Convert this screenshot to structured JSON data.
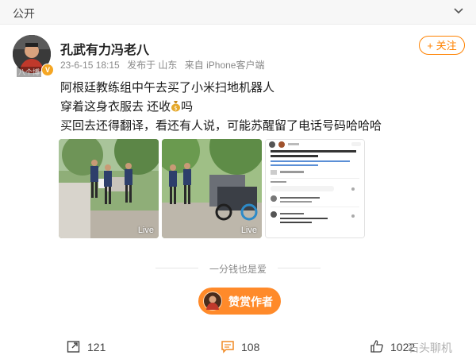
{
  "header": {
    "visibility": "公开"
  },
  "author": {
    "name": "孔武有力冯老八",
    "avatar_caption": "八个博",
    "verified_badge": "V",
    "meta": {
      "date": "23-6-15 18:15",
      "published_from": "发布于 山东",
      "device": "来自 iPhone客户端"
    }
  },
  "follow_button": {
    "label": "+ 关注"
  },
  "post": {
    "line1": "阿根廷教练组中午去买了小米扫地机器人",
    "line2_before": "穿着这身衣服去 还收",
    "line2_after": "吗",
    "line3": "买回去还得翻译，看还有人说，可能苏醒留了电话号码哈哈哈"
  },
  "images": [
    {
      "kind": "photo",
      "live": "Live"
    },
    {
      "kind": "photo",
      "live": "Live"
    },
    {
      "kind": "screenshot",
      "live": ""
    }
  ],
  "divider_text": "一分钱也是爱",
  "tip_button": {
    "label": "赞赏作者"
  },
  "actions": {
    "repost": "121",
    "comment": "108",
    "like": "1022"
  },
  "watermark": "石头聊机",
  "colors": {
    "accent": "#ff8200",
    "tip_bg": "#ff8a2a",
    "comment_icon": "#f08a24"
  }
}
